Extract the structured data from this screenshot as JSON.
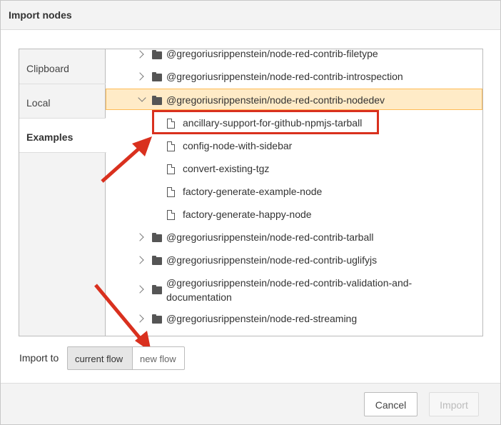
{
  "dialog": {
    "title": "Import nodes"
  },
  "tabs": [
    {
      "label": "Clipboard"
    },
    {
      "label": "Local"
    },
    {
      "label": "Examples"
    }
  ],
  "tree": {
    "rows": [
      {
        "label": "@gregoriusrippenstein/node-red-contrib-filetype",
        "kind": "folder",
        "state": "collapsed"
      },
      {
        "label": "@gregoriusrippenstein/node-red-contrib-introspection",
        "kind": "folder",
        "state": "collapsed"
      },
      {
        "label": "@gregoriusrippenstein/node-red-contrib-nodedev",
        "kind": "folder",
        "state": "expanded"
      },
      {
        "label": "ancillary-support-for-github-npmjs-tarball",
        "kind": "file"
      },
      {
        "label": "config-node-with-sidebar",
        "kind": "file"
      },
      {
        "label": "convert-existing-tgz",
        "kind": "file"
      },
      {
        "label": "factory-generate-example-node",
        "kind": "file"
      },
      {
        "label": "factory-generate-happy-node",
        "kind": "file"
      },
      {
        "label": "@gregoriusrippenstein/node-red-contrib-tarball",
        "kind": "folder",
        "state": "collapsed"
      },
      {
        "label": "@gregoriusrippenstein/node-red-contrib-uglifyjs",
        "kind": "folder",
        "state": "collapsed"
      },
      {
        "label_line1": "@gregoriusrippenstein/node-red-contrib-validation-and-",
        "label_line2": "documentation",
        "kind": "folder",
        "state": "collapsed"
      },
      {
        "label": "@gregoriusrippenstein/node-red-streaming",
        "kind": "folder",
        "state": "collapsed"
      }
    ]
  },
  "import_to": {
    "label": "Import to",
    "options": [
      {
        "label": "current flow",
        "selected": true
      },
      {
        "label": "new flow",
        "selected": false
      }
    ]
  },
  "footer": {
    "cancel": "Cancel",
    "import": "Import"
  },
  "colors": {
    "selection_bg": "#ffebc7",
    "selection_border": "#ffbb55",
    "annotation_red": "#d9301e"
  }
}
